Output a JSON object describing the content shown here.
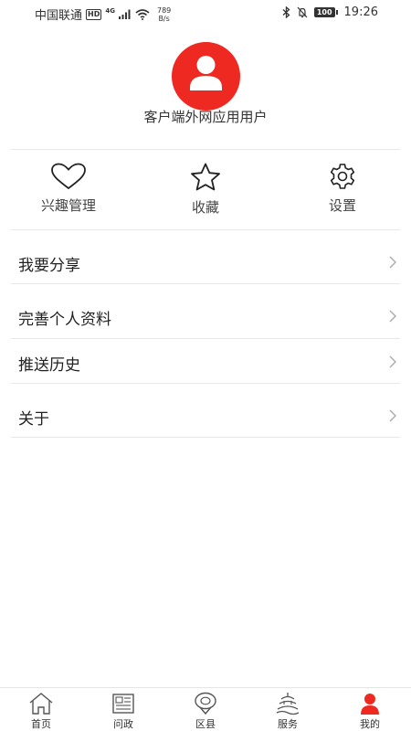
{
  "status_bar": {
    "carrier": "中国联通",
    "hd": "HD",
    "network": "4G",
    "speed_value": "789",
    "speed_unit": "B/s",
    "battery": "100",
    "time": "19:26"
  },
  "profile": {
    "username": "客户端外网应用用户",
    "avatar_color": "#ee2922"
  },
  "quick_actions": [
    {
      "label": "兴趣管理",
      "icon": "heart-icon"
    },
    {
      "label": "收藏",
      "icon": "star-icon"
    },
    {
      "label": "设置",
      "icon": "gear-icon"
    }
  ],
  "menu": [
    {
      "label": "我要分享"
    },
    {
      "label": "完善个人资料"
    },
    {
      "label": "推送历史"
    },
    {
      "label": "关于"
    }
  ],
  "bottom_nav": [
    {
      "label": "首页",
      "icon": "home-icon",
      "active": false
    },
    {
      "label": "问政",
      "icon": "newspaper-icon",
      "active": false
    },
    {
      "label": "区县",
      "icon": "location-icon",
      "active": false
    },
    {
      "label": "服务",
      "icon": "temple-icon",
      "active": false
    },
    {
      "label": "我的",
      "icon": "user-icon",
      "active": true
    }
  ],
  "colors": {
    "accent": "#ee2922",
    "divider": "#e8e8e8",
    "text": "#222222"
  }
}
